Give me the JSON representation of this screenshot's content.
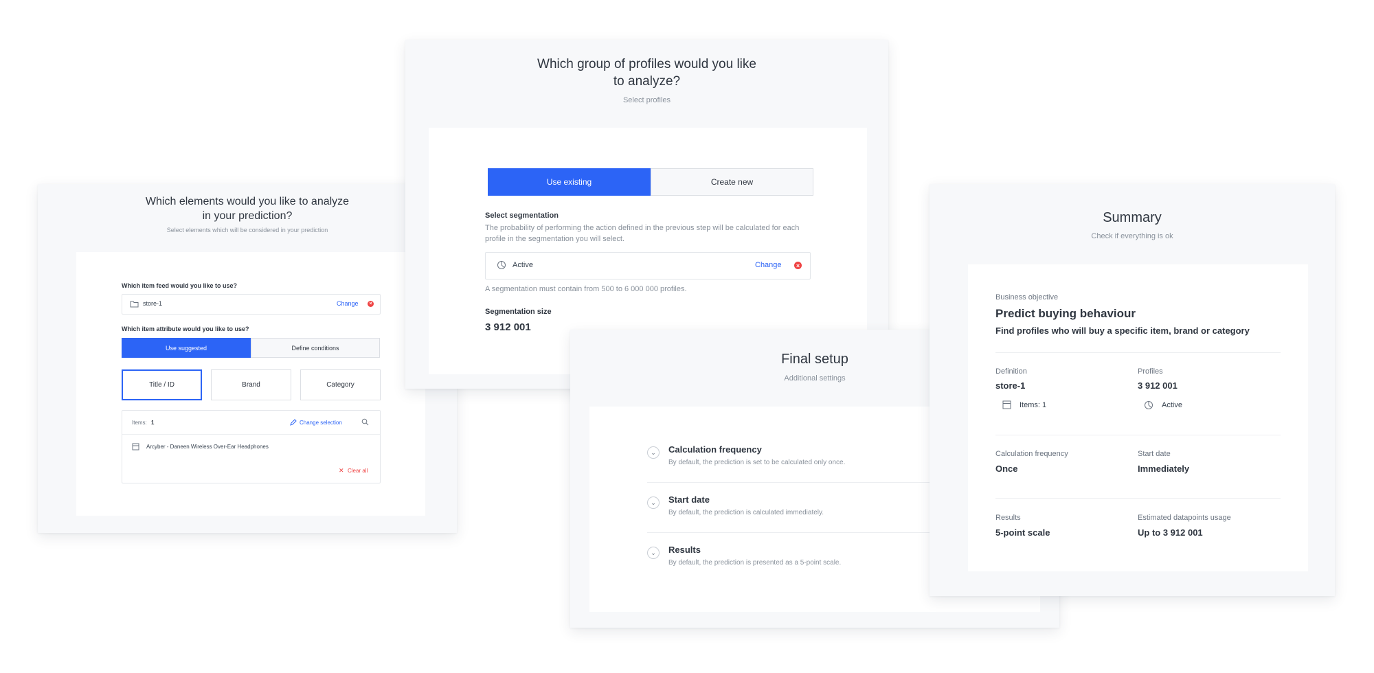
{
  "elements_panel": {
    "title": "Which elements would you like to analyze in your prediction?",
    "subtitle": "Select elements which will be considered in your prediction",
    "feed_question": "Which item feed would you like to use?",
    "feed_value": "store-1",
    "feed_change": "Change",
    "attribute_question": "Which item attribute would you like to use?",
    "tab_suggested": "Use suggested",
    "tab_conditions": "Define conditions",
    "options": [
      "Title / ID",
      "Brand",
      "Category"
    ],
    "items_label": "Items:",
    "items_count": "1",
    "change_selection": "Change selection",
    "item_name": "Arcyber - Daneen Wireless Over-Ear Headphones",
    "clear_all": "Clear all"
  },
  "profiles_panel": {
    "title": "Which group of profiles would you like to analyze?",
    "subtitle": "Select profiles",
    "tab_existing": "Use existing",
    "tab_new": "Create new",
    "seg_label": "Select segmentation",
    "seg_desc": "The probability of performing the action defined in the previous step will be calculated for each profile in the segmentation you will select.",
    "seg_value": "Active",
    "seg_change": "Change",
    "seg_hint": "A segmentation must contain from 500 to 6 000 000 profiles.",
    "size_label": "Segmentation size",
    "size_value": "3 912 001"
  },
  "final_panel": {
    "title": "Final setup",
    "subtitle": "Additional settings",
    "settings": [
      {
        "title": "Calculation frequency",
        "desc": "By default, the prediction is set to be calculated only once."
      },
      {
        "title": "Start date",
        "desc": "By default, the prediction is calculated immediately."
      },
      {
        "title": "Results",
        "desc": "By default, the prediction is presented as a 5-point scale."
      }
    ]
  },
  "summary_panel": {
    "title": "Summary",
    "subtitle": "Check if everything is ok",
    "objective_label": "Business objective",
    "objective_title": "Predict buying behaviour",
    "objective_desc": "Find profiles who will buy a specific item, brand or category",
    "definition_label": "Definition",
    "definition_value": "store-1",
    "definition_items": "Items: 1",
    "profiles_label": "Profiles",
    "profiles_value": "3 912 001",
    "profiles_seg": "Active",
    "freq_label": "Calculation frequency",
    "freq_value": "Once",
    "start_label": "Start date",
    "start_value": "Immediately",
    "results_label": "Results",
    "results_value": "5-point scale",
    "usage_label": "Estimated datapoints usage",
    "usage_value": "Up to 3 912 001"
  },
  "colors": {
    "accent": "#2c64f6",
    "danger": "#ef4444"
  }
}
